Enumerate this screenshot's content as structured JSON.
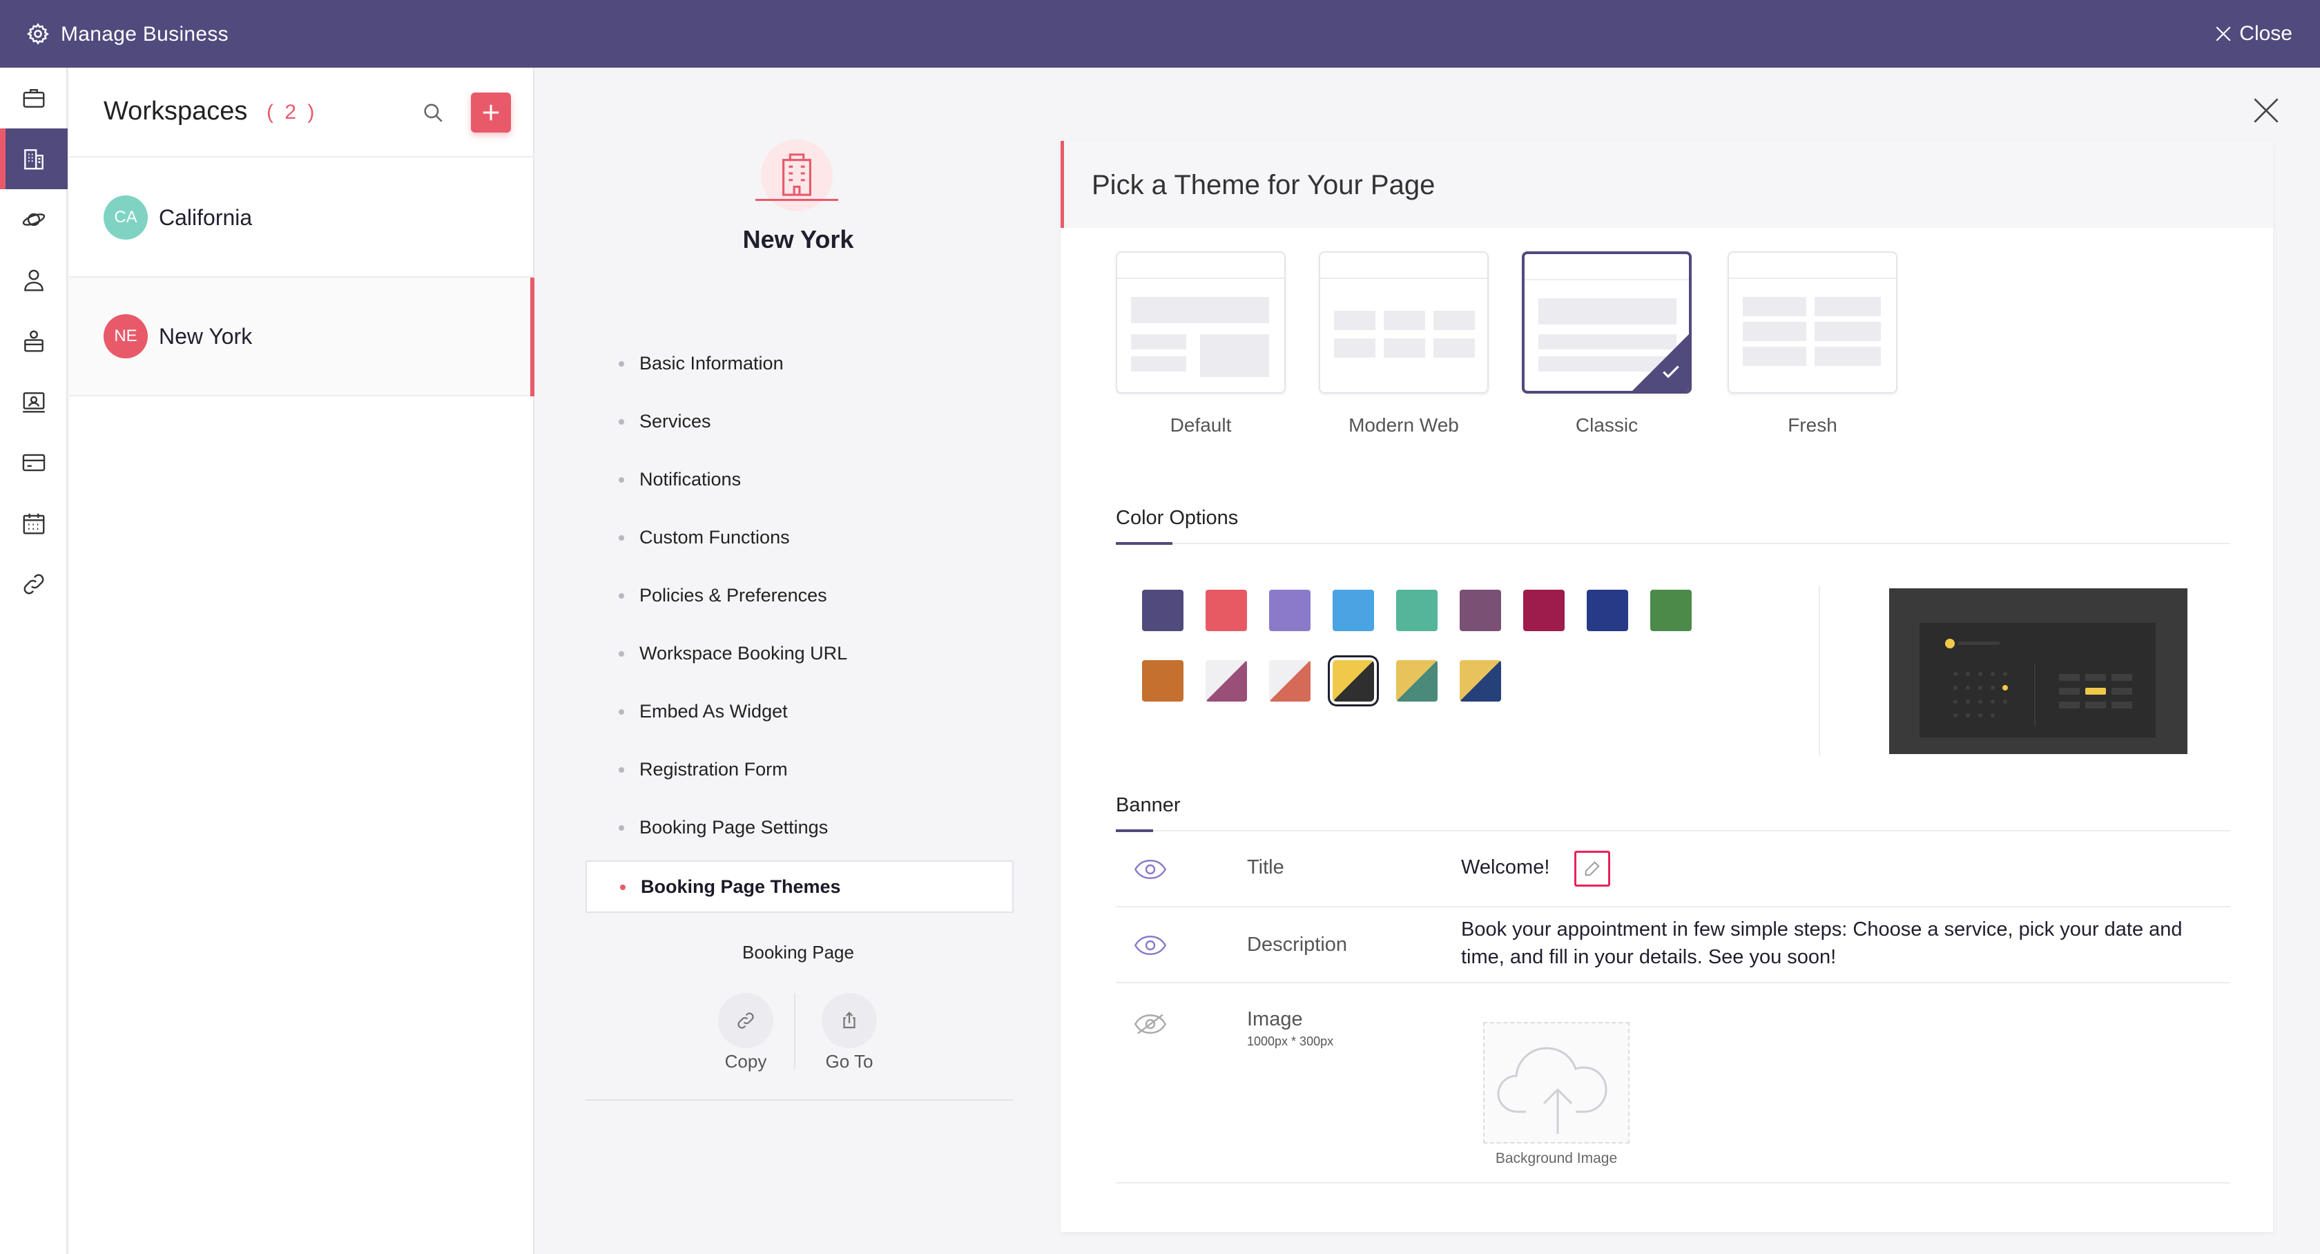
{
  "topbar": {
    "title": "Manage Business",
    "close_label": "Close"
  },
  "rail": {
    "items": [
      "briefcase-icon",
      "building-icon",
      "planet-icon",
      "users-icon",
      "staff-icon",
      "customer-icon",
      "card-icon",
      "calendar-icon",
      "link-icon"
    ],
    "active_index": 1
  },
  "workspaces": {
    "title": "Workspaces",
    "count": "( 2 )",
    "items": [
      {
        "initials": "CA",
        "name": "California",
        "color": "#7fd3c3"
      },
      {
        "initials": "NE",
        "name": "New York",
        "color": "#e85a6a"
      }
    ],
    "active_index": 1
  },
  "workspace_detail": {
    "name": "New York",
    "menu": [
      "Basic Information",
      "Services",
      "Notifications",
      "Custom Functions",
      "Policies & Preferences",
      "Workspace Booking URL",
      "Embed As Widget",
      "Registration Form",
      "Booking Page Settings",
      "Booking Page Themes"
    ],
    "active_menu_index": 9,
    "booking_page": {
      "label": "Booking Page",
      "copy_label": "Copy",
      "goto_label": "Go To"
    }
  },
  "theme_panel": {
    "title": "Pick a Theme for Your Page",
    "themes": [
      "Default",
      "Modern Web",
      "Classic",
      "Fresh"
    ],
    "selected_theme": "Classic",
    "color_options": {
      "title": "Color Options",
      "solid": [
        "#514a7d",
        "#e85a63",
        "#8b7ac9",
        "#4aa3e2",
        "#54b59a",
        "#7a5074",
        "#9e1c4c",
        "#263a87",
        "#4c8a4a",
        "#c5702f"
      ],
      "split": [
        {
          "a": "#f0f0f2",
          "b": "#9a4f79"
        },
        {
          "a": "#f0f0f2",
          "b": "#d46a57"
        },
        {
          "a": "#f0c94a",
          "b": "#2f2f2f"
        },
        {
          "a": "#e8c25a",
          "b": "#4a8a7a"
        },
        {
          "a": "#e8c25a",
          "b": "#26407a"
        }
      ],
      "selected_split_index": 2
    },
    "banner": {
      "title": "Banner",
      "rows": [
        {
          "label": "Title",
          "value": "Welcome!",
          "visible": true
        },
        {
          "label": "Description",
          "value": "Book your appointment in few simple steps: Choose a service, pick your date and time, and fill in your details. See you soon!",
          "visible": true
        },
        {
          "label": "Image",
          "hint": "1000px * 300px",
          "visible": false,
          "upload_caption": "Background Image"
        }
      ]
    },
    "accent_color": "#e85a6a",
    "brand_color": "#514a7d"
  }
}
